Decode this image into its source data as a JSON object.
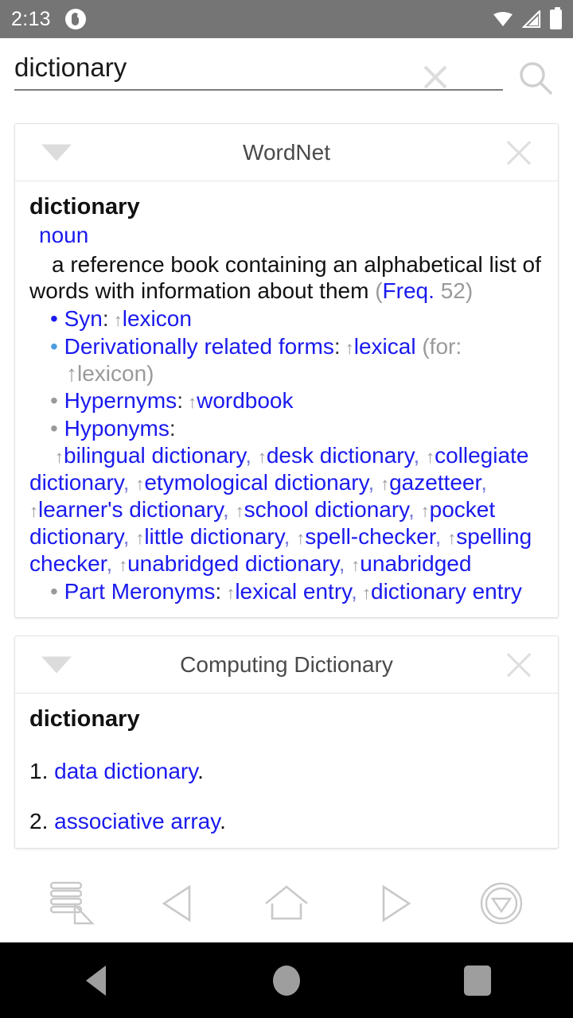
{
  "status_bar": {
    "time": "2:13",
    "app_icon": "notification-app-icon",
    "wifi_icon": "wifi-icon",
    "signal_icon": "cell-signal-icon",
    "battery_icon": "battery-full-icon"
  },
  "search": {
    "value": "dictionary",
    "placeholder": "Search",
    "clear_icon": "close-icon",
    "submit_icon": "search-icon"
  },
  "colors": {
    "link_blue": "#1a1aee",
    "bullet_deriv": "#4d9de0",
    "bullet_gray": "#9a9a9a",
    "muted_gray": "#9a9a9a",
    "status_bar_bg": "#757575",
    "card_border": "#e2e2e2"
  },
  "cards": [
    {
      "title": "WordNet",
      "collapse_icon": "caret-down-icon",
      "close_icon": "close-icon",
      "headword": "dictionary",
      "pos": "noun",
      "definition": "a reference book containing an alphabetical list of words with information about them",
      "freq_label": "Freq.",
      "freq_value": "52",
      "relations": [
        {
          "bullet": "blue",
          "label": "Syn",
          "terms": [
            "lexicon"
          ],
          "suffix": ""
        },
        {
          "bullet": "deriv",
          "label": "Derivationally related forms",
          "terms": [
            "lexical"
          ],
          "suffix": "(for: ↑lexicon)"
        },
        {
          "bullet": "gray",
          "label": "Hypernyms",
          "terms": [
            "wordbook"
          ],
          "suffix": ""
        },
        {
          "bullet": "gray",
          "label": "Hyponyms",
          "terms": [
            "bilingual dictionary",
            "desk dictionary",
            "collegiate dictionary",
            "etymological dictionary",
            "gazetteer",
            "learner's dictionary",
            "school dictionary",
            "pocket dictionary",
            "little dictionary",
            "spell-checker",
            "spelling checker",
            "unabridged dictionary",
            "unabridged"
          ],
          "suffix": ""
        },
        {
          "bullet": "gray",
          "label": "Part Meronyms",
          "terms": [
            "lexical entry",
            "dictionary entry"
          ],
          "suffix": ""
        }
      ]
    },
    {
      "title": "Computing Dictionary",
      "collapse_icon": "caret-down-icon",
      "close_icon": "close-icon",
      "headword": "dictionary",
      "entries": [
        {
          "number": "1.",
          "term": "data dictionary",
          "period": "."
        },
        {
          "number": "2.",
          "term": "associative array",
          "period": "."
        }
      ]
    }
  ],
  "toolbar": [
    {
      "name": "library-stack-icon",
      "label": "Library"
    },
    {
      "name": "back-arrow-icon",
      "label": "Back"
    },
    {
      "name": "home-icon",
      "label": "Home"
    },
    {
      "name": "forward-arrow-icon",
      "label": "Forward"
    },
    {
      "name": "scroll-down-circle-icon",
      "label": "Scroll down"
    }
  ],
  "android_nav": [
    {
      "name": "android-back-icon"
    },
    {
      "name": "android-home-icon"
    },
    {
      "name": "android-recents-icon"
    }
  ]
}
